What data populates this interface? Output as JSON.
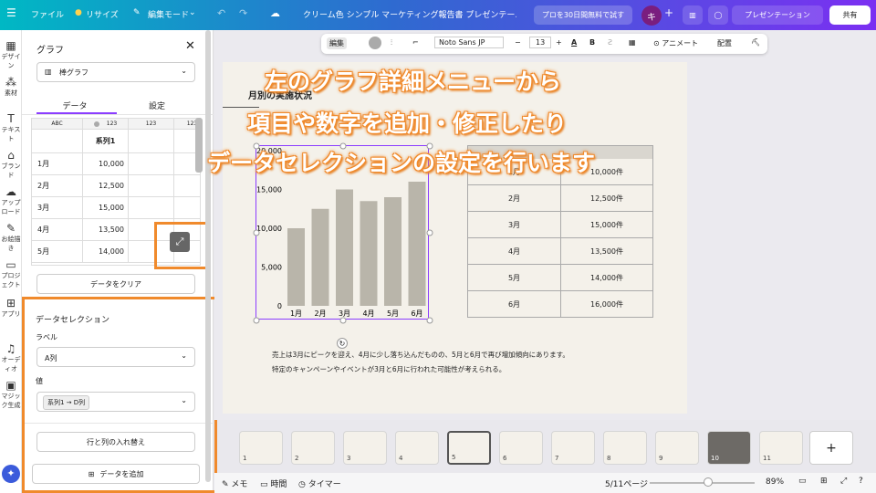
{
  "topbar": {
    "menu": "☰",
    "file": "ファイル",
    "resize": "リサイズ",
    "edit_mode": "編集モード",
    "title": "クリーム色 シンプル マーケティング報告書 プレゼンテー…",
    "promo": "プロを30日間無料で試す",
    "avatar": "キ",
    "presentation": "プレゼンテーション",
    "share": "共有"
  },
  "rail": [
    "デザイン",
    "素材",
    "テキスト",
    "ブランド",
    "アップロード",
    "お絵描き",
    "プロジェクト",
    "アプリ",
    "オーディオ",
    "マジック生成"
  ],
  "panel": {
    "title": "グラフ",
    "chart_type": "棒グラフ",
    "tab_data": "データ",
    "tab_settings": "設定",
    "grid_headers": [
      "ABC",
      "123",
      "123",
      "123"
    ],
    "series_header": "系列1",
    "rows": [
      [
        "1月",
        "10,000"
      ],
      [
        "2月",
        "12,500"
      ],
      [
        "3月",
        "15,000"
      ],
      [
        "4月",
        "13,500"
      ],
      [
        "5月",
        "14,000"
      ]
    ],
    "clear": "データをクリア",
    "selection_title": "データセレクション",
    "label_title": "ラベル",
    "label_value": "A列",
    "value_title": "値",
    "value_chip": "系列1 → D列",
    "swap": "行と列の入れ替え",
    "add_data": "データを追加"
  },
  "toolbar": {
    "edit": "編集",
    "font": "Noto Sans JP",
    "size": "13",
    "animate": "アニメート",
    "arrange": "配置"
  },
  "slide": {
    "heading": "月別の実施状況",
    "table": [
      [
        "1月",
        "10,000件"
      ],
      [
        "2月",
        "12,500件"
      ],
      [
        "3月",
        "15,000件"
      ],
      [
        "4月",
        "13,500件"
      ],
      [
        "5月",
        "14,000件"
      ],
      [
        "6月",
        "16,000件"
      ]
    ],
    "note1": "売上は3月にピークを迎え、4月に少し落ち込んだものの、5月と6月で再び増加傾向にあります。",
    "note2": "特定のキャンペーンやイベントが3月と6月に行われた可能性が考えられる。"
  },
  "overlay": [
    "左のグラフ詳細メニューから",
    "項目や数字を追加・修正したり",
    "データセレクションの設定を行います"
  ],
  "bottom": {
    "memo": "メモ",
    "timer_label": "時間",
    "timer2": "タイマー",
    "page": "5/11ページ",
    "zoom": "89%",
    "add": "+"
  },
  "thumbs": [
    "1",
    "2",
    "3",
    "4",
    "5",
    "6",
    "7",
    "8",
    "9",
    "10",
    "11"
  ],
  "chart_data": {
    "type": "bar",
    "categories": [
      "1月",
      "2月",
      "3月",
      "4月",
      "5月",
      "6月"
    ],
    "values": [
      10000,
      12500,
      15000,
      13500,
      14000,
      16000
    ],
    "ylim": [
      0,
      20000
    ],
    "yticks": [
      "0",
      "5,000",
      "10,000",
      "15,000",
      "20,000"
    ]
  },
  "colors": {
    "bar": "#b9b5aa",
    "accent": "#f08a2c",
    "selection": "#8b3dff",
    "table_head": "#d9d6cf"
  }
}
